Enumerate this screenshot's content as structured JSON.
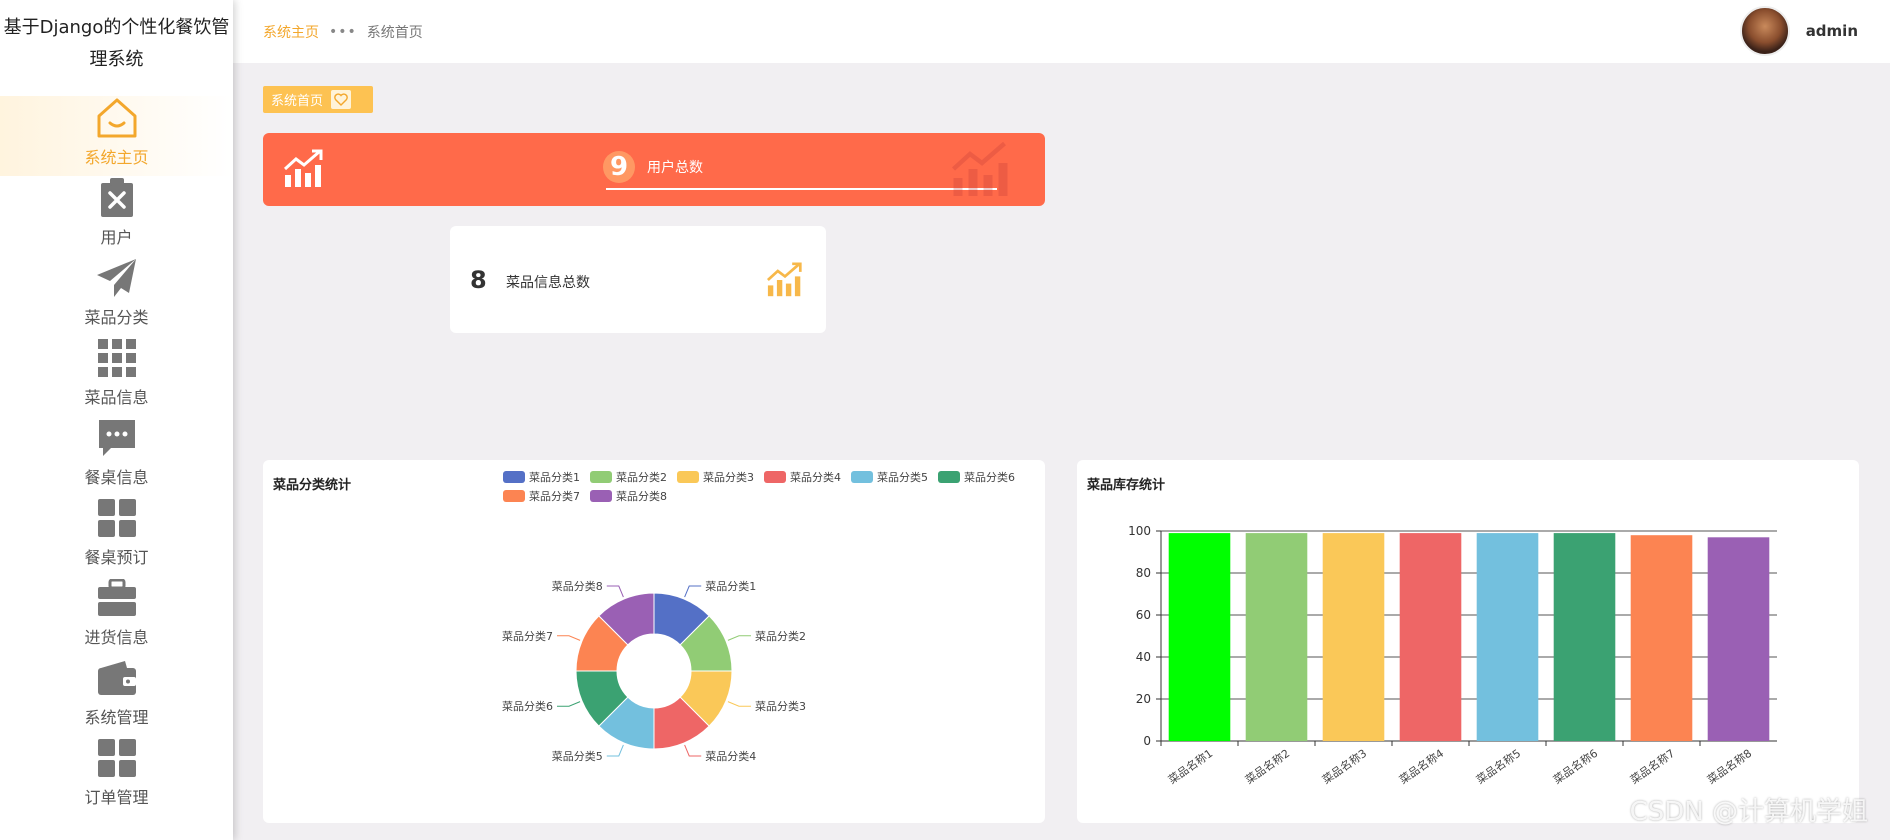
{
  "app": {
    "title": "基于Django的个性化餐饮管理系统"
  },
  "sidebar": {
    "items": [
      {
        "label": "系统主页",
        "icon": "home-icon",
        "active": true
      },
      {
        "label": "用户",
        "icon": "clipboard-x-icon"
      },
      {
        "label": "菜品分类",
        "icon": "paper-plane-icon"
      },
      {
        "label": "菜品信息",
        "icon": "grid-icon"
      },
      {
        "label": "餐桌信息",
        "icon": "chat-bubble-icon"
      },
      {
        "label": "餐桌预订",
        "icon": "four-squares-icon"
      },
      {
        "label": "进货信息",
        "icon": "briefcase-icon"
      },
      {
        "label": "系统管理",
        "icon": "wallet-icon"
      },
      {
        "label": "订单管理",
        "icon": "four-squares-icon"
      }
    ]
  },
  "header": {
    "breadcrumb_home": "系统主页",
    "breadcrumb_sep": "•••",
    "breadcrumb_current": "系统首页",
    "username": "admin"
  },
  "page_tag": {
    "label": "系统首页"
  },
  "stats": {
    "users": {
      "value": "9",
      "label": "用户总数"
    },
    "dishes": {
      "value": "8",
      "label": "菜品信息总数"
    }
  },
  "colors": {
    "accent": "#f3a72c",
    "users_card": "#ff6a4a",
    "palette": [
      "#5470c6",
      "#91cc75",
      "#fac858",
      "#ee6666",
      "#73c0de",
      "#3ba272",
      "#fc8452",
      "#9a60b4"
    ]
  },
  "chart_data": [
    {
      "type": "pie",
      "title": "菜品分类统计",
      "donut": true,
      "legend_position": "top-right",
      "categories": [
        "菜品分类1",
        "菜品分类2",
        "菜品分类3",
        "菜品分类4",
        "菜品分类5",
        "菜品分类6",
        "菜品分类7",
        "菜品分类8"
      ],
      "values": [
        1,
        1,
        1,
        1,
        1,
        1,
        1,
        1
      ]
    },
    {
      "type": "bar",
      "title": "菜品库存统计",
      "categories": [
        "菜品名称1",
        "菜品名称2",
        "菜品名称3",
        "菜品名称4",
        "菜品名称5",
        "菜品名称6",
        "菜品名称7",
        "菜品名称8"
      ],
      "values": [
        99,
        99,
        99,
        99,
        99,
        99,
        98,
        97
      ],
      "bar_colors": [
        "#00ff00",
        "#91cc75",
        "#fac858",
        "#ee6666",
        "#73c0de",
        "#3ba272",
        "#fc8452",
        "#9a60b4"
      ],
      "ylim": [
        0,
        100
      ],
      "yticks": [
        0,
        20,
        40,
        60,
        80,
        100
      ],
      "grid": true
    }
  ],
  "watermark": "CSDN @计算机学姐"
}
